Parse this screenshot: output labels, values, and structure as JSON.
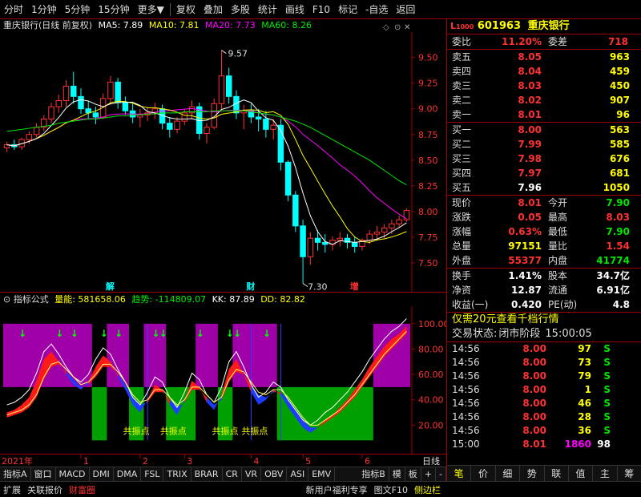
{
  "toolbar": {
    "items": [
      "分时",
      "1分钟",
      "5分钟",
      "15分钟",
      "更多",
      "复权",
      "叠加",
      "多股",
      "统计",
      "画线",
      "F10",
      "标记",
      "-自选",
      "返回"
    ]
  },
  "main_chart": {
    "legend": {
      "title": "重庆银行(日线 前复权)",
      "ma5": "MA5: 7.89",
      "ma10": "MA10: 7.81",
      "ma20": "MA20: 7.73",
      "ma60": "MA60: 8.26"
    },
    "markers": {
      "high_label": "9.57",
      "low_label": "7.30",
      "ann_jie": "解",
      "ann_cai": "财",
      "ann_zeng": "增"
    },
    "colors": {
      "ma5": "#ffffff",
      "ma10": "#ffff00",
      "ma20": "#ff00ff",
      "ma60": "#00e600",
      "up": "#ff3232",
      "down": "#00ffff"
    }
  },
  "indicator": {
    "header": {
      "name": "指标公式",
      "liangneng": "量能: 581658.06",
      "qushi": "趋势: -114809.07",
      "kk": "KK: 87.89",
      "dd": "DD: 82.82"
    },
    "signal_label": "共振点"
  },
  "axis_strip": {
    "year": "2021年",
    "months": [
      "1",
      "2",
      "3",
      "4",
      "5",
      "6"
    ],
    "right": "日线"
  },
  "tabs": [
    "指标A",
    "窗口",
    "MACD",
    "DMI",
    "DMA",
    "FSL",
    "TRIX",
    "BRAR",
    "CR",
    "VR",
    "OBV",
    "ASI",
    "EMV",
    "指标B",
    "模",
    "板",
    "+",
    "-"
  ],
  "bottom": {
    "left": [
      "扩展",
      "关联报价",
      "财富圈"
    ],
    "right": [
      "新用户福利专享",
      "图文F10",
      "侧边栏"
    ]
  },
  "quote": {
    "code": "601963",
    "name": "重庆银行",
    "weibi_label": "委比",
    "weibi": "11.20%",
    "weicha_label": "委差",
    "weicha": "718",
    "asks": [
      {
        "label": "卖五",
        "price": "8.05",
        "vol": "963"
      },
      {
        "label": "卖四",
        "price": "8.04",
        "vol": "459"
      },
      {
        "label": "卖三",
        "price": "8.03",
        "vol": "450"
      },
      {
        "label": "卖二",
        "price": "8.02",
        "vol": "907"
      },
      {
        "label": "卖一",
        "price": "8.01",
        "vol": "96"
      }
    ],
    "bids": [
      {
        "label": "买一",
        "price": "8.00",
        "vol": "563"
      },
      {
        "label": "买二",
        "price": "7.99",
        "vol": "585"
      },
      {
        "label": "买三",
        "price": "7.98",
        "vol": "676"
      },
      {
        "label": "买四",
        "price": "7.97",
        "vol": "681"
      },
      {
        "label": "买五",
        "price": "7.96",
        "vol": "1050"
      }
    ],
    "stats": [
      {
        "l1": "现价",
        "v1": "8.01",
        "l2": "今开",
        "v2": "7.90",
        "c1": "red",
        "c2": "green"
      },
      {
        "l1": "涨跌",
        "v1": "0.05",
        "l2": "最高",
        "v2": "8.03",
        "c1": "red",
        "c2": "red"
      },
      {
        "l1": "涨幅",
        "v1": "0.63%",
        "l2": "最低",
        "v2": "7.90",
        "c1": "red",
        "c2": "green"
      },
      {
        "l1": "总量",
        "v1": "97151",
        "l2": "量比",
        "v2": "1.54",
        "c1": "yellow",
        "c2": "red"
      },
      {
        "l1": "外盘",
        "v1": "55377",
        "l2": "内盘",
        "v2": "41774",
        "c1": "red",
        "c2": "green"
      }
    ],
    "stats2": [
      {
        "l1": "换手",
        "v1": "1.41%",
        "l2": "股本",
        "v2": "34.7亿"
      },
      {
        "l1": "净资",
        "v1": "12.87",
        "l2": "流通",
        "v2": "6.91亿"
      },
      {
        "l1": "收益(一)",
        "v1": "0.420",
        "l2": "PE(动)",
        "v2": "4.8"
      }
    ],
    "promo": "仅需20元查看千档行情",
    "status_label": "交易状态:",
    "status_value": "闭市阶段",
    "status_time": "15:00:05",
    "trades": [
      {
        "t": "14:56",
        "p": "8.00",
        "v": "97",
        "s": "S"
      },
      {
        "t": "14:56",
        "p": "8.00",
        "v": "73",
        "s": "S"
      },
      {
        "t": "14:56",
        "p": "8.00",
        "v": "79",
        "s": "S"
      },
      {
        "t": "14:56",
        "p": "8.00",
        "v": "1",
        "s": "S"
      },
      {
        "t": "14:56",
        "p": "8.00",
        "v": "46",
        "s": "S"
      },
      {
        "t": "14:56",
        "p": "8.00",
        "v": "28",
        "s": "S"
      },
      {
        "t": "14:56",
        "p": "8.00",
        "v": "36",
        "s": "S"
      },
      {
        "t": "15:00",
        "p": "8.01",
        "v": "1860",
        "s": "98"
      }
    ],
    "rp_tabs": [
      "笔",
      "价",
      "细",
      "势",
      "联",
      "值",
      "主",
      "筹"
    ]
  },
  "chart_data": {
    "type": "line",
    "price_axis": [
      9.5,
      9.25,
      9.0,
      8.75,
      8.5,
      8.25,
      8.0,
      7.75,
      7.5
    ],
    "ylim": [
      7.25,
      9.7
    ],
    "ind_axis": [
      100.0,
      80.0,
      60.0,
      40.0,
      20.0
    ],
    "ind_ylim": [
      0,
      110
    ],
    "candles": [
      [
        8.62,
        8.68,
        8.58,
        8.65
      ],
      [
        8.65,
        8.7,
        8.6,
        8.63
      ],
      [
        8.63,
        8.72,
        8.6,
        8.7
      ],
      [
        8.7,
        8.78,
        8.66,
        8.75
      ],
      [
        8.75,
        8.86,
        8.72,
        8.82
      ],
      [
        8.82,
        8.94,
        8.78,
        8.9
      ],
      [
        8.9,
        9.06,
        8.86,
        9.02
      ],
      [
        9.02,
        9.14,
        8.96,
        9.08
      ],
      [
        9.08,
        9.28,
        9.02,
        9.22
      ],
      [
        9.22,
        9.36,
        9.05,
        9.12
      ],
      [
        9.12,
        9.2,
        8.95,
        9.0
      ],
      [
        9.0,
        9.08,
        8.9,
        8.96
      ],
      [
        8.96,
        9.02,
        8.85,
        8.92
      ],
      [
        8.92,
        9.15,
        8.9,
        9.1
      ],
      [
        9.1,
        9.32,
        9.05,
        9.26
      ],
      [
        9.26,
        9.3,
        9.0,
        9.06
      ],
      [
        9.06,
        9.12,
        8.94,
        8.98
      ],
      [
        8.98,
        9.05,
        8.86,
        8.92
      ],
      [
        8.92,
        9.0,
        8.82,
        8.94
      ],
      [
        8.94,
        9.02,
        8.88,
        8.96
      ],
      [
        8.96,
        9.06,
        8.9,
        9.0
      ],
      [
        9.0,
        9.04,
        8.8,
        8.86
      ],
      [
        8.86,
        8.92,
        8.72,
        8.8
      ],
      [
        8.8,
        8.92,
        8.76,
        8.88
      ],
      [
        8.88,
        9.0,
        8.84,
        8.96
      ],
      [
        8.96,
        9.08,
        8.9,
        9.02
      ],
      [
        9.02,
        9.06,
        8.7,
        8.76
      ],
      [
        8.76,
        8.86,
        8.66,
        8.82
      ],
      [
        8.82,
        9.1,
        8.8,
        9.05
      ],
      [
        9.05,
        9.57,
        9.0,
        9.32
      ],
      [
        9.32,
        9.4,
        9.05,
        9.12
      ],
      [
        9.12,
        9.18,
        8.9,
        8.96
      ],
      [
        8.96,
        9.04,
        8.8,
        8.98
      ],
      [
        8.98,
        9.05,
        8.86,
        8.92
      ],
      [
        8.92,
        9.0,
        8.78,
        8.9
      ],
      [
        8.9,
        8.98,
        8.72,
        8.8
      ],
      [
        8.8,
        8.9,
        8.7,
        8.84
      ],
      [
        8.84,
        8.9,
        8.4,
        8.48
      ],
      [
        8.48,
        8.5,
        8.1,
        8.16
      ],
      [
        8.16,
        8.2,
        7.8,
        7.86
      ],
      [
        7.86,
        7.92,
        7.3,
        7.56
      ],
      [
        7.56,
        7.8,
        7.48,
        7.74
      ],
      [
        7.74,
        7.82,
        7.62,
        7.7
      ],
      [
        7.7,
        7.78,
        7.6,
        7.68
      ],
      [
        7.68,
        7.76,
        7.62,
        7.72
      ],
      [
        7.72,
        7.8,
        7.66,
        7.74
      ],
      [
        7.74,
        7.78,
        7.64,
        7.7
      ],
      [
        7.7,
        7.76,
        7.6,
        7.66
      ],
      [
        7.66,
        7.74,
        7.62,
        7.72
      ],
      [
        7.72,
        7.82,
        7.68,
        7.78
      ],
      [
        7.78,
        7.86,
        7.72,
        7.8
      ],
      [
        7.8,
        7.88,
        7.74,
        7.84
      ],
      [
        7.84,
        7.92,
        7.78,
        7.88
      ],
      [
        7.88,
        7.96,
        7.84,
        7.92
      ],
      [
        7.92,
        8.03,
        7.9,
        8.01
      ]
    ],
    "ma60": [
      8.78,
      8.79,
      8.8,
      8.81,
      8.82,
      8.83,
      8.84,
      8.86,
      8.87,
      8.88,
      8.89,
      8.9,
      8.9,
      8.91,
      8.92,
      8.93,
      8.93,
      8.94,
      8.94,
      8.95,
      8.95,
      8.96,
      8.96,
      8.96,
      8.97,
      8.97,
      8.97,
      8.97,
      8.98,
      8.98,
      8.98,
      8.98,
      8.98,
      8.97,
      8.96,
      8.95,
      8.94,
      8.92,
      8.9,
      8.88,
      8.85,
      8.82,
      8.78,
      8.74,
      8.7,
      8.66,
      8.62,
      8.58,
      8.54,
      8.5,
      8.45,
      8.4,
      8.35,
      8.3,
      8.26
    ],
    "ind_fast": [
      30,
      32,
      36,
      42,
      55,
      72,
      78,
      70,
      60,
      52,
      48,
      54,
      66,
      75,
      70,
      58,
      48,
      36,
      30,
      40,
      52,
      48,
      36,
      28,
      40,
      55,
      50,
      38,
      32,
      44,
      64,
      72,
      60,
      46,
      36,
      40,
      48,
      44,
      34,
      26,
      18,
      14,
      18,
      24,
      28,
      34,
      40,
      48,
      56,
      66,
      74,
      82,
      88,
      92,
      98
    ],
    "ind_slow": [
      26,
      28,
      30,
      34,
      42,
      56,
      66,
      68,
      62,
      56,
      50,
      52,
      58,
      66,
      66,
      60,
      52,
      42,
      36,
      38,
      46,
      46,
      40,
      34,
      38,
      48,
      48,
      42,
      36,
      40,
      54,
      62,
      60,
      52,
      44,
      42,
      46,
      46,
      40,
      32,
      24,
      18,
      18,
      22,
      26,
      30,
      36,
      42,
      50,
      58,
      66,
      74,
      80,
      86,
      92
    ],
    "purple_zones": [
      [
        0,
        12
      ],
      [
        14,
        17
      ],
      [
        19,
        22
      ],
      [
        26,
        29
      ],
      [
        31,
        37
      ],
      [
        50,
        55
      ]
    ],
    "green_zones": [
      [
        12,
        14
      ],
      [
        17,
        19
      ],
      [
        22,
        26
      ],
      [
        29,
        31
      ],
      [
        37,
        50
      ]
    ],
    "signal_idx": [
      17,
      22,
      29,
      33
    ],
    "arrow_idx": [
      2,
      7,
      9,
      13,
      15,
      20,
      21,
      26,
      30,
      31,
      35
    ]
  }
}
